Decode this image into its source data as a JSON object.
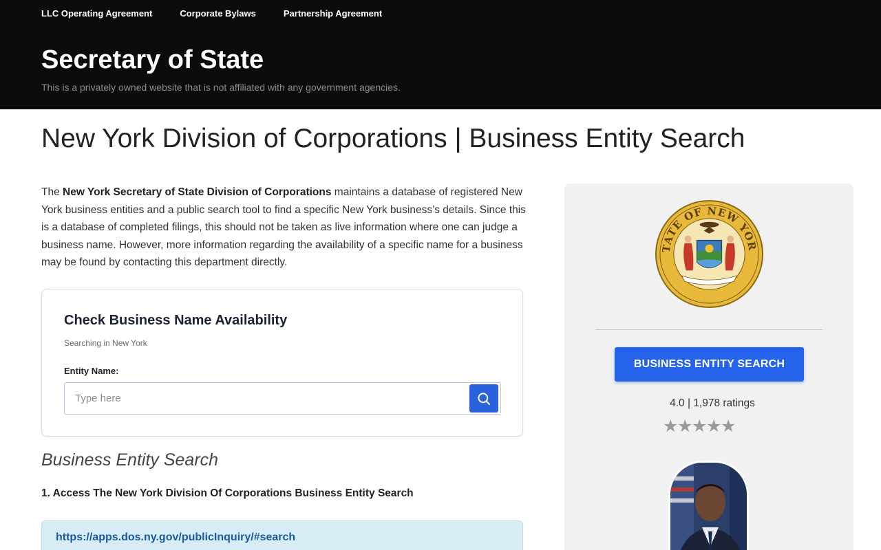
{
  "nav": {
    "items": [
      "LLC Operating Agreement",
      "Corporate Bylaws",
      "Partnership Agreement"
    ]
  },
  "header": {
    "site_title": "Secretary of State",
    "disclaimer": "This is a privately owned website that is not affiliated with any government agencies."
  },
  "page": {
    "title": "New York Division of Corporations | Business Entity Search"
  },
  "intro": {
    "prefix": "The ",
    "bold": "New York Secretary of State Division of Corporations",
    "rest": " maintains a database of registered New York business entities and a public search tool to find a specific New York business’s details. Since this is a database of completed filings, this should not be taken as live information where one can judge a business name. However, more information regarding the availability of a specific name for a business may be found by contacting this department directly."
  },
  "check": {
    "title": "Check Business Name Availability",
    "subtitle": "Searching in New York",
    "field_label": "Entity Name:",
    "placeholder": "Type here",
    "search_icon": "search-icon"
  },
  "section": {
    "heading": "Business Entity Search",
    "step1": "1. Access The New York Division Of Corporations Business Entity Search",
    "link": "https://apps.dos.ny.gov/publicInquiry/#search"
  },
  "sidebar": {
    "seal_text": "STATE OF NEW YORK",
    "button_label": "BUSINESS ENTITY SEARCH",
    "rating_text": "4.0 | 1,978 ratings",
    "rating_value": 4.0,
    "rating_max": 5,
    "star_glyphs": [
      "★",
      "★",
      "★",
      "★",
      "★"
    ],
    "star_color": "#9a9a9a"
  },
  "colors": {
    "header_bg": "#0c0c0c",
    "accent_blue": "#2563eb",
    "link_blue": "#1b5aa0",
    "link_box_bg": "#d8ecf6",
    "sidebar_bg": "#f1f1f1"
  }
}
